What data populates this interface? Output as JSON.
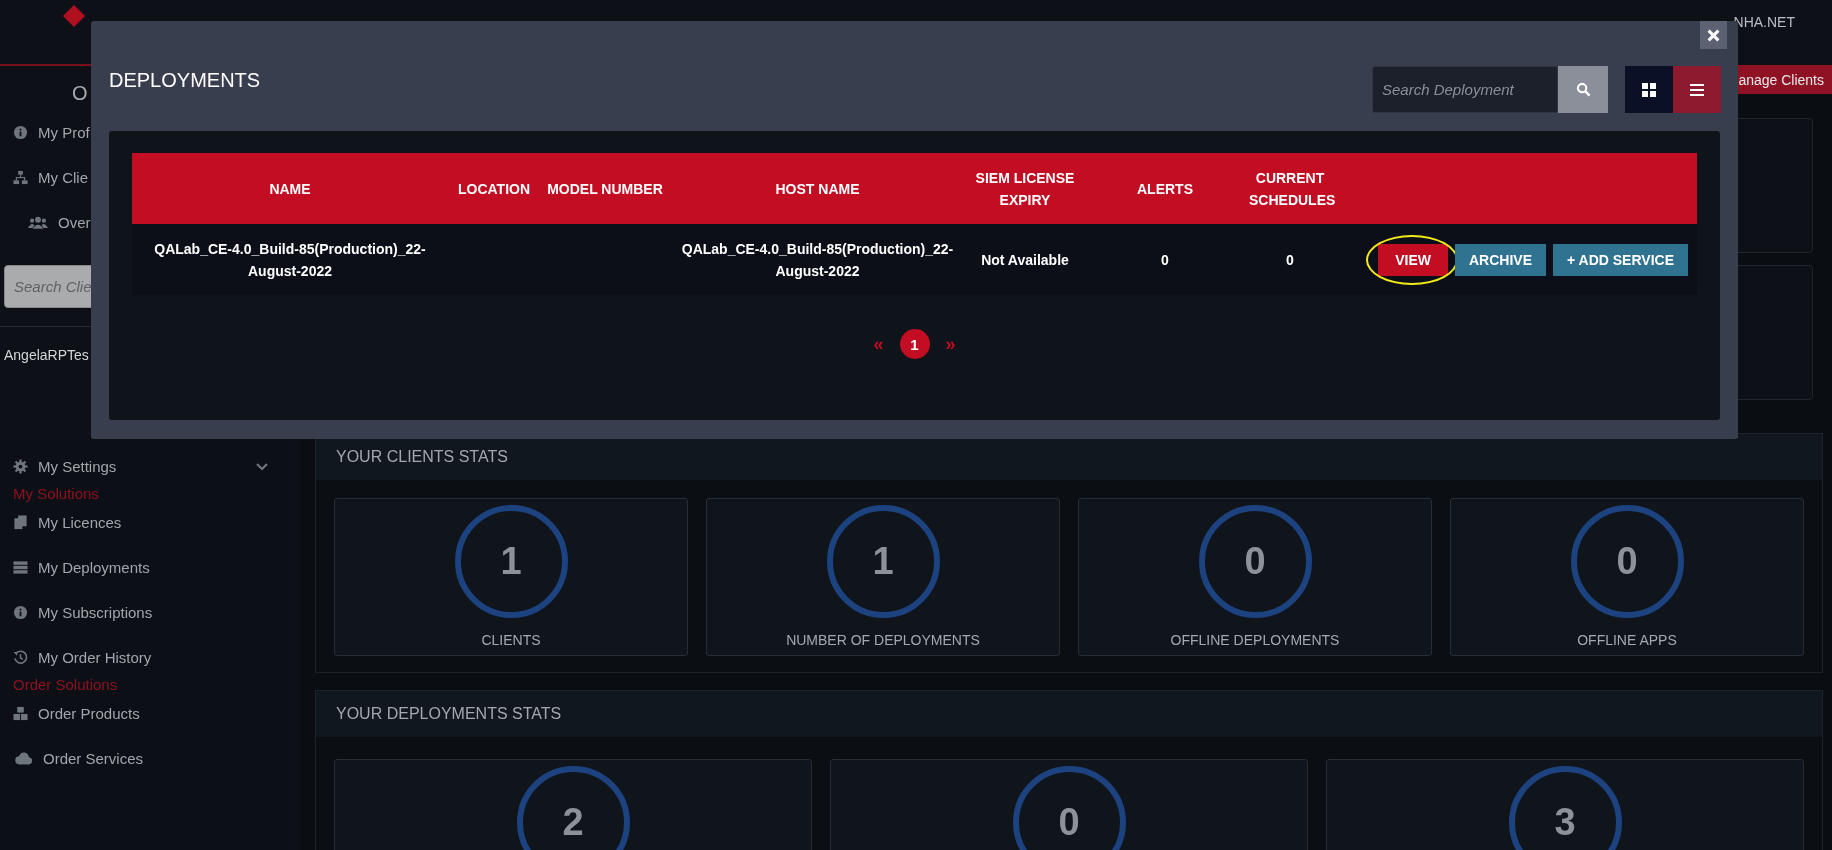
{
  "header": {
    "account_text": "NHA.NET"
  },
  "sidebar": {
    "heading": "O",
    "profile_items": [
      {
        "label": "My Prof"
      },
      {
        "label": "My Clie",
        "children": [
          {
            "label": "Over"
          }
        ]
      }
    ],
    "client_search": {
      "placeholder": "Search Clie"
    },
    "clients": [
      {
        "label": "AngelaRPTes"
      }
    ],
    "settings": {
      "label": "My Settings",
      "expanded": false
    },
    "sections": [
      {
        "title": "My Solutions",
        "items": [
          {
            "label": "My Licences"
          },
          {
            "label": "My Deployments"
          },
          {
            "label": "My Subscriptions"
          },
          {
            "label": "My Order History"
          }
        ]
      },
      {
        "title": "Order Solutions",
        "items": [
          {
            "label": "Order Products"
          },
          {
            "label": "Order Services"
          }
        ]
      }
    ]
  },
  "main": {
    "manage_button": "anage Clients",
    "clients_stats": {
      "title": "YOUR CLIENTS STATS",
      "cards": [
        {
          "value": "1",
          "label": "CLIENTS"
        },
        {
          "value": "1",
          "label": "NUMBER OF DEPLOYMENTS"
        },
        {
          "value": "0",
          "label": "OFFLINE DEPLOYMENTS"
        },
        {
          "value": "0",
          "label": "OFFLINE APPS"
        }
      ]
    },
    "deployments_stats": {
      "title": "YOUR DEPLOYMENTS STATS",
      "cards": [
        {
          "value": "2"
        },
        {
          "value": "0"
        },
        {
          "value": "3"
        }
      ]
    }
  },
  "modal": {
    "title": "DEPLOYMENTS",
    "search": {
      "placeholder": "Search Deployment"
    },
    "view_modes": [
      {
        "selected": false
      },
      {
        "selected": true
      }
    ],
    "table": {
      "columns": [
        "NAME",
        "LOCATION",
        "MODEL NUMBER",
        "HOST NAME",
        "SIEM LICENSE EXPIRY",
        "ALERTS",
        "CURRENT SCHEDULES"
      ],
      "rows": [
        {
          "cells": [
            "QALab_CE-4.0_Build-85(Production)_22-August-2022",
            "",
            "",
            "QALab_CE-4.0_Build-85(Production)_22-August-2022",
            "Not Available",
            "0",
            "0"
          ],
          "actions": [
            {
              "label": "VIEW",
              "kind": "primary",
              "circled": true
            },
            {
              "label": "ARCHIVE",
              "kind": "secondary",
              "circled": false
            },
            {
              "label": "+ ADD SERVICE",
              "kind": "secondary",
              "circled": false
            }
          ]
        }
      ]
    },
    "pagination": {
      "prev": "«",
      "pages": [
        {
          "label": "1",
          "selected": true
        }
      ],
      "next": "»"
    }
  }
}
